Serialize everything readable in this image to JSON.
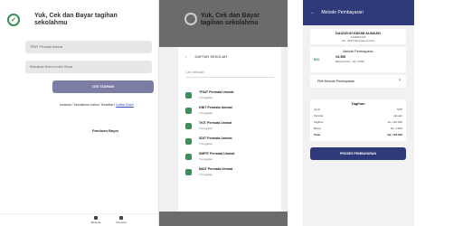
{
  "login": {
    "title": "Yuk, Cek dan Bayar tagihan sekolahmu",
    "school_value": "TPAIT Permata Ummat",
    "student_id_placeholder": "Masukkan Nomor Induk Siswa",
    "submit_label": "CEK TAGIHAN",
    "register_text": "Instansi / Sekolahmu belum Terdaftar?",
    "register_link": "Daftar Disini",
    "guide_label": "Panduan Bayar",
    "nav": [
      {
        "label": "Beranda"
      },
      {
        "label": "Informasi"
      }
    ]
  },
  "school_picker": {
    "title": "Yuk, Cek dan Bayar tagihan sekolahmu",
    "sheet_title": "DAFTAR SEKOLAH",
    "search_placeholder": "Cari Sekolah",
    "schools": [
      {
        "name": "TPAIT Permata Ummat",
        "city": "Trenggalek"
      },
      {
        "name": "KBIT Permata Ummat",
        "city": "Trenggalek"
      },
      {
        "name": "TKIT Permata Ummat",
        "city": "Trenggalek"
      },
      {
        "name": "SDIT Permata Ummat",
        "city": "Trenggalek"
      },
      {
        "name": "SMPIT Permata Ummat",
        "city": "Trenggalek"
      },
      {
        "name": "MAIT Permata Ummat",
        "city": "Trenggalek"
      }
    ]
  },
  "payment": {
    "header_title": "Metode Pembayaran",
    "student_name": "DAUDZUN HAKIM ALWAJID",
    "student_id": "1234567222",
    "student_school": "5A - SDIT Permata Ummat",
    "method_title": "Metode Pembayaran",
    "bank_logo": "BSI",
    "va_label": "VA BSI",
    "va_fee": "Biaya Admin : Rp 3.500,-",
    "choose_method": "Pilih Metode Pembayaran",
    "bill_title": "Tagihan",
    "rows": [
      {
        "label": "Jenis",
        "value": "SPP"
      },
      {
        "label": "Periode",
        "value": "Januari"
      },
      {
        "label": "Tagihan",
        "value": "Rp. 120.000"
      },
      {
        "label": "Biaya",
        "value": "Rp. 3.500"
      },
      {
        "label": "Total",
        "value": "Rp. 123.500"
      }
    ],
    "pay_label": "PROSES PEMBAYARAN"
  },
  "colors": {
    "primary": "#2e3a79",
    "accent_green": "#3a8f56",
    "button_muted": "#7b7da5"
  }
}
